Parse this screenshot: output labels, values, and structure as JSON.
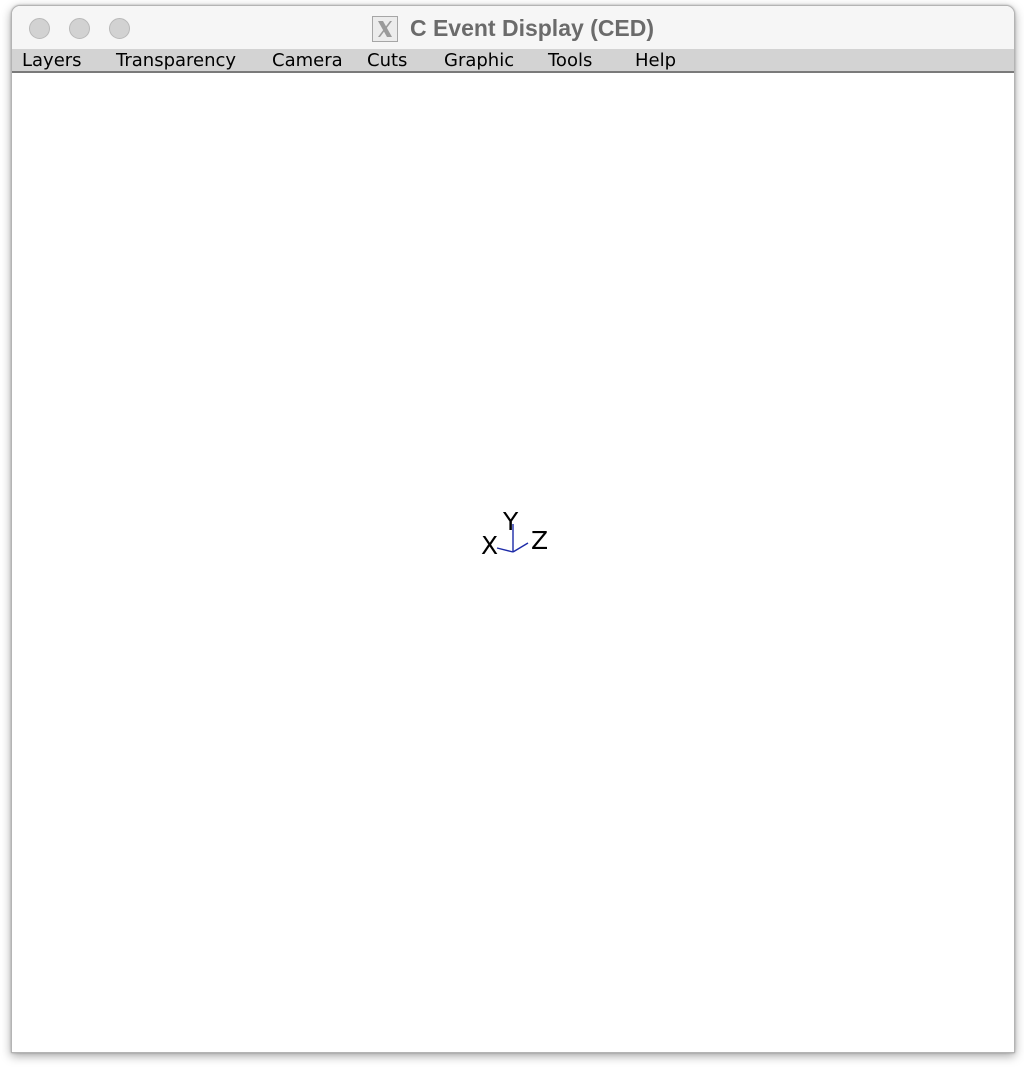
{
  "window": {
    "title": "C Event Display (CED)",
    "app_icon": "x11-icon"
  },
  "menubar": {
    "items": [
      {
        "label": "Layers"
      },
      {
        "label": "Transparency"
      },
      {
        "label": "Camera"
      },
      {
        "label": "Cuts"
      },
      {
        "label": "Graphic"
      },
      {
        "label": "Tools"
      },
      {
        "label": "Help"
      }
    ]
  },
  "viewport": {
    "axes": {
      "x_label": "X",
      "y_label": "Y",
      "z_label": "Z"
    },
    "colors": {
      "background": "#ffffff",
      "axis_line": "#1d2ba8"
    }
  }
}
